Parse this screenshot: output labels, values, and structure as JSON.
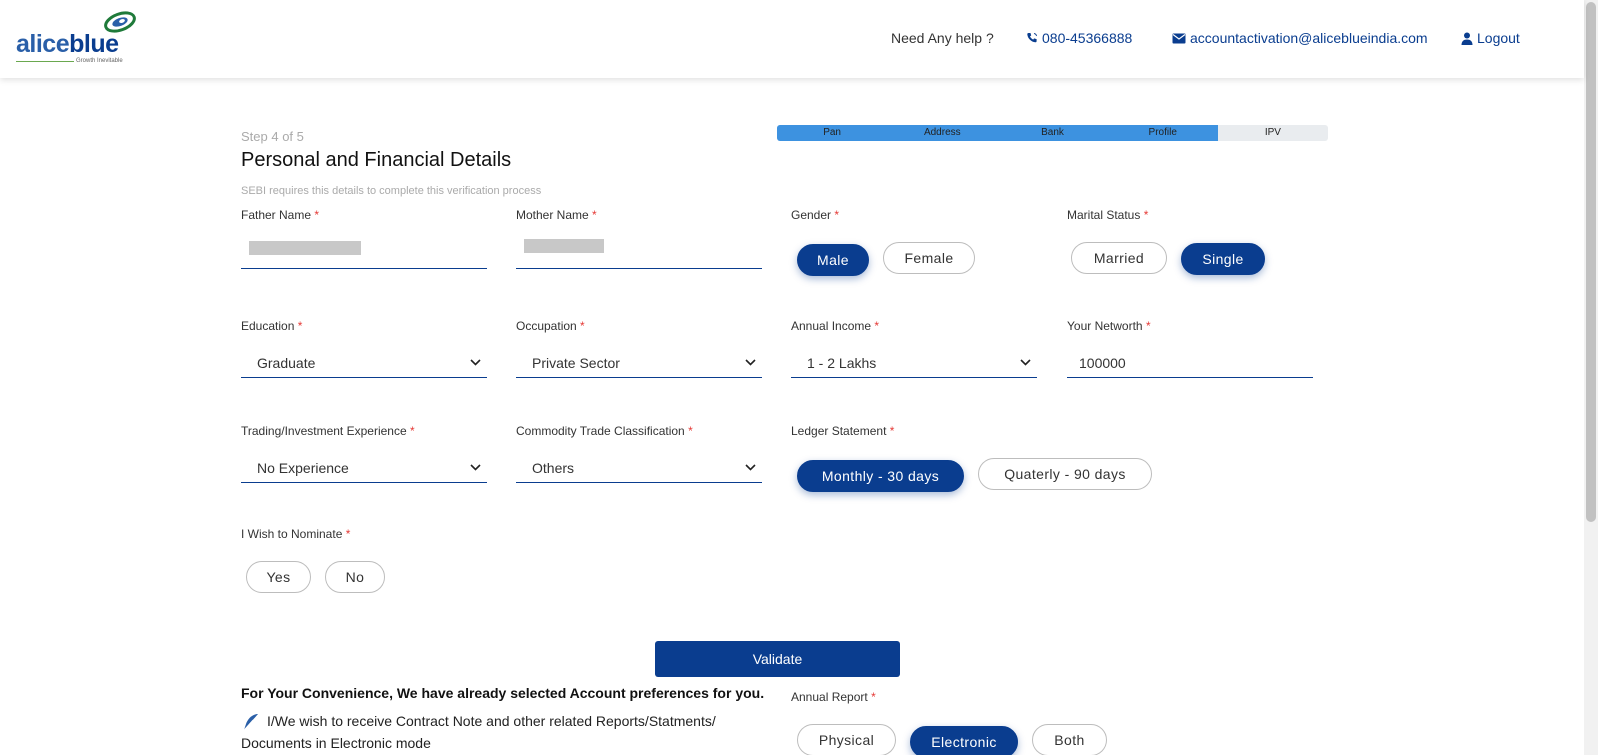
{
  "header": {
    "logo_text_1": "alice",
    "logo_text_2": "blue",
    "logo_tagline": "Growth Inevitable",
    "help_text": "Need Any help ?",
    "phone": "080-45366888",
    "email": "accountactivation@aliceblueindia.com",
    "logout": "Logout"
  },
  "page": {
    "step": "Step 4 of 5",
    "title": "Personal and Financial Details",
    "subtitle": "SEBI requires this details to complete this verification process"
  },
  "progress": {
    "steps": [
      "Pan",
      "Address",
      "Bank",
      "Profile",
      "IPV"
    ],
    "completed_fraction": 0.8
  },
  "form": {
    "father_name": {
      "label": "Father Name",
      "required": "*"
    },
    "mother_name": {
      "label": "Mother Name",
      "required": "*"
    },
    "gender": {
      "label": "Gender",
      "required": "*",
      "options": [
        "Male",
        "Female"
      ],
      "selected": "Male"
    },
    "marital_status": {
      "label": "Marital Status",
      "required": "*",
      "options": [
        "Married",
        "Single"
      ],
      "selected": "Single"
    },
    "education": {
      "label": "Education",
      "required": "*",
      "value": "Graduate"
    },
    "occupation": {
      "label": "Occupation",
      "required": "*",
      "value": "Private Sector"
    },
    "annual_income": {
      "label": "Annual Income",
      "required": "*",
      "value": "1 - 2 Lakhs"
    },
    "networth": {
      "label": "Your Networth",
      "required": "*",
      "value": "100000"
    },
    "experience": {
      "label": "Trading/Investment Experience",
      "required": "*",
      "value": "No Experience"
    },
    "commodity": {
      "label": "Commodity Trade Classification",
      "required": "*",
      "value": "Others"
    },
    "ledger": {
      "label": "Ledger Statement",
      "required": "*",
      "options": [
        "Monthly - 30 days",
        "Quaterly - 90 days"
      ],
      "selected": "Monthly - 30 days"
    },
    "nominate": {
      "label": "I Wish to Nominate",
      "required": "*",
      "options": [
        "Yes",
        "No"
      ]
    }
  },
  "validate_label": "Validate",
  "preferences": {
    "heading": "For Your Convenience, We have already selected Account preferences for you.",
    "line1": "I/We wish to receive Contract Note and other related Reports/Statments/",
    "line2": "Documents in Electronic mode",
    "annual_report": {
      "label": "Annual Report",
      "required": "*",
      "options": [
        "Physical",
        "Electronic",
        "Both"
      ],
      "selected": "Electronic"
    }
  },
  "colors": {
    "brand": "#0a3d8f",
    "progress": "#3d92e0",
    "required": "#e53935"
  }
}
